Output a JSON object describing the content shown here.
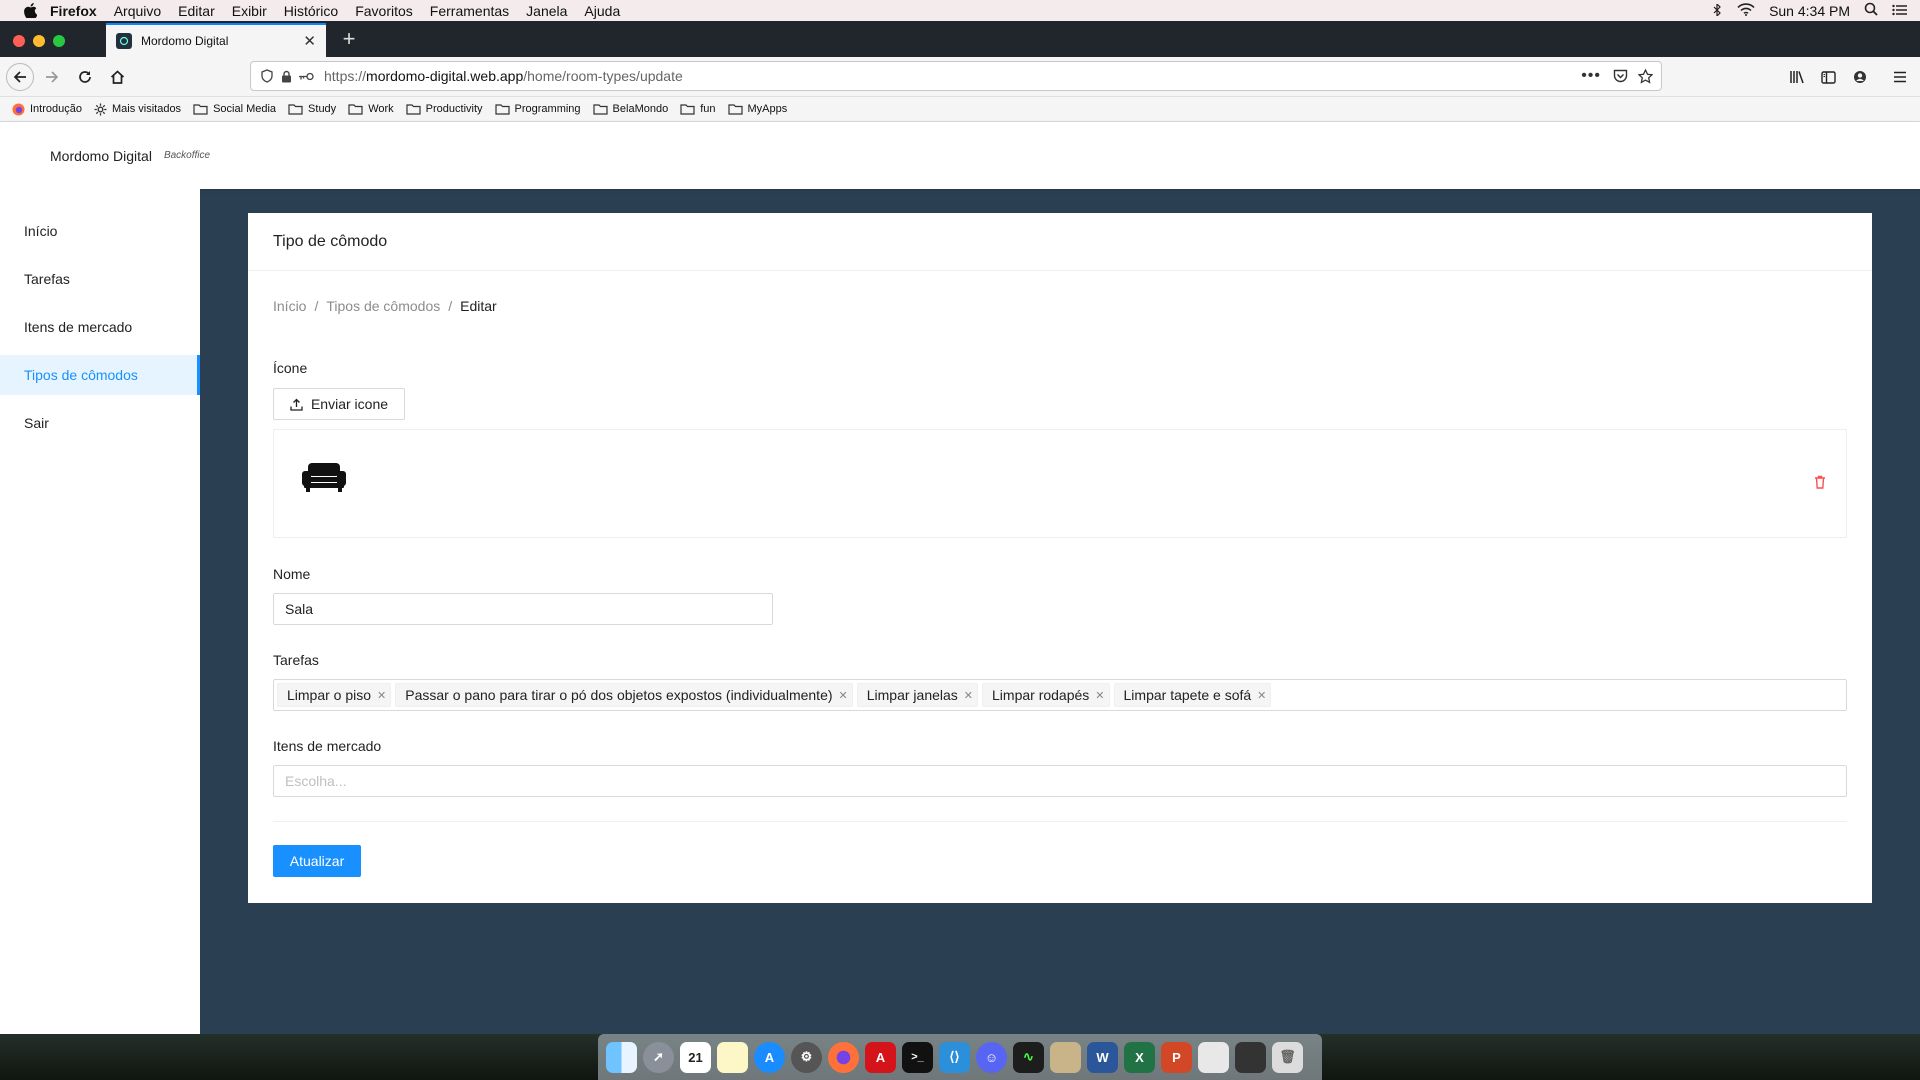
{
  "menubar": {
    "app": "Firefox",
    "items": [
      "Arquivo",
      "Editar",
      "Exibir",
      "Histórico",
      "Favoritos",
      "Ferramentas",
      "Janela",
      "Ajuda"
    ],
    "clock": "Sun 4:34 PM"
  },
  "browser": {
    "tab_title": "Mordomo Digital",
    "url_protocol": "https://",
    "url_host": "mordomo-digital.web.app",
    "url_path": "/home/room-types/update",
    "bookmarks": [
      "Introdução",
      "Mais visitados",
      "Social Media",
      "Study",
      "Work",
      "Productivity",
      "Programming",
      "BelaMondo",
      "fun",
      "MyApps"
    ]
  },
  "app": {
    "brand": "Mordomo Digital",
    "subtitle": "Backoffice"
  },
  "sidebar": {
    "items": [
      {
        "label": "Início"
      },
      {
        "label": "Tarefas"
      },
      {
        "label": "Itens de mercado"
      },
      {
        "label": "Tipos de cômodos",
        "active": true
      },
      {
        "label": "Sair"
      }
    ]
  },
  "card": {
    "title": "Tipo de cômodo",
    "breadcrumb": [
      "Início",
      "Tipos de cômodos",
      "Editar"
    ],
    "icon_label": "Ícone",
    "upload_label": "Enviar icone",
    "icon_name": "sofa-icon",
    "name_label": "Nome",
    "name_value": "Sala",
    "tasks_label": "Tarefas",
    "tasks": [
      "Limpar o piso",
      "Passar o pano para tirar o pó dos objetos expostos (individualmente)",
      "Limpar janelas",
      "Limpar rodapés",
      "Limpar tapete e sofá"
    ],
    "market_label": "Itens de mercado",
    "market_placeholder": "Escolha...",
    "submit_label": "Atualizar"
  },
  "colors": {
    "primary": "#1890ff",
    "content_bg": "#2b3f52",
    "danger": "#ff4d4f"
  }
}
